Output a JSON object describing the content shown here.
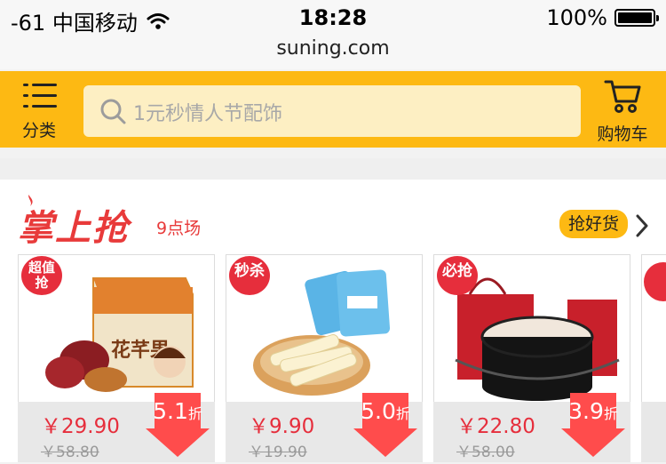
{
  "status_bar": {
    "carrier": "-61 中国移动",
    "time": "18:28",
    "battery": "100%"
  },
  "browser": {
    "url": "suning.com"
  },
  "header": {
    "category_label": "分类",
    "search_placeholder": "1元秒情人节配饰",
    "cart_label": "购物车",
    "accent_color": "#fdb913"
  },
  "flash_sale": {
    "title": "掌上抢",
    "session": "9点场",
    "good_deals_label": "抢好货",
    "products": [
      {
        "badge": "超值\n抢",
        "price": "￥29.90",
        "original_price": "￥58.80",
        "discount_num": "5.1",
        "discount_unit": "折",
        "product_text": "花芊果"
      },
      {
        "badge": "秒杀",
        "price": "￥9.90",
        "original_price": "￥19.90",
        "discount_num": "5.0",
        "discount_unit": "折"
      },
      {
        "badge": "必抢",
        "price": "￥22.80",
        "original_price": "￥58.00",
        "discount_num": "3.9",
        "discount_unit": "折"
      }
    ]
  }
}
